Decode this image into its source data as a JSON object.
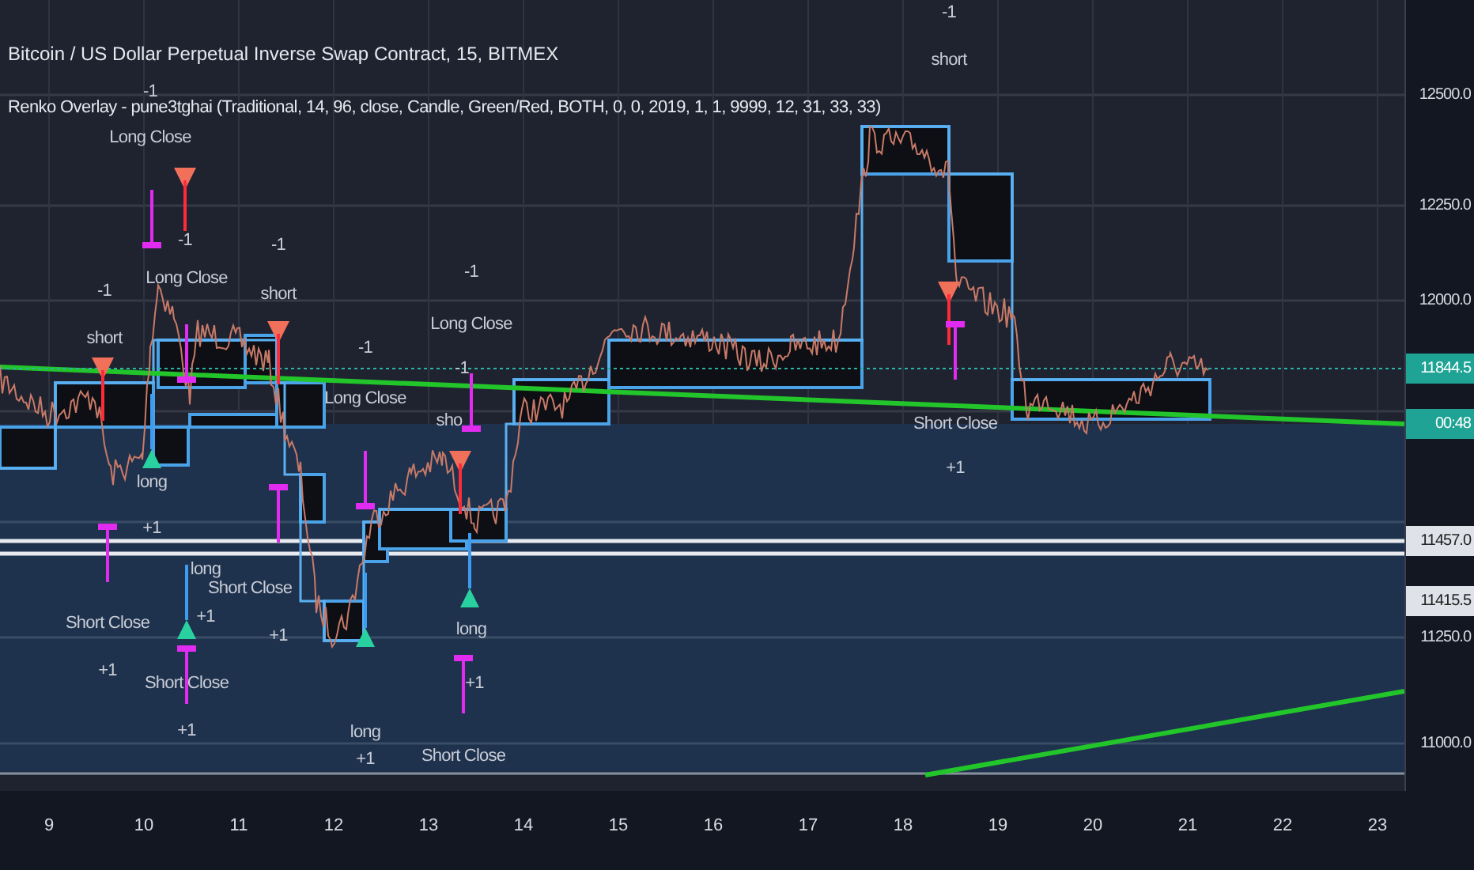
{
  "chart": {
    "title": "Bitcoin / US Dollar Perpetual Inverse Swap Contract, 15, BITMEX",
    "indicator": "Renko Overlay - pune3tghai (Traditional, 14, 96, close, Candle, Green/Red, BOTH, 0, 0, 2019, 1, 1, 9999, 12, 31, 33, 33)",
    "signal_labels": [
      {
        "text": "-1"
      },
      {
        "text": "Long Close"
      },
      {
        "text": "-1"
      },
      {
        "text": "Long Close"
      },
      {
        "text": "-1"
      },
      {
        "text": "short"
      },
      {
        "text": "-1"
      },
      {
        "text": "short"
      },
      {
        "text": "-1"
      },
      {
        "text": "Long Close"
      },
      {
        "text": "-1"
      },
      {
        "text": "Long Close"
      },
      {
        "text": "-1"
      },
      {
        "text": "sho"
      },
      {
        "text": "long"
      },
      {
        "text": "+1"
      },
      {
        "text": "long"
      },
      {
        "text": "+1"
      },
      {
        "text": "Short Close"
      },
      {
        "text": "+1"
      },
      {
        "text": "Short Close"
      },
      {
        "text": "+1"
      },
      {
        "text": "Short Close"
      },
      {
        "text": "+1"
      },
      {
        "text": "long"
      },
      {
        "text": "+1"
      },
      {
        "text": "long"
      },
      {
        "text": "+1"
      },
      {
        "text": "Short Close"
      },
      {
        "text": "-1"
      },
      {
        "text": "short"
      },
      {
        "text": "Short Close"
      },
      {
        "text": "+1"
      }
    ],
    "price_axis": {
      "ticks": [
        "12500.0",
        "12250.0",
        "12000.0",
        "11250.0",
        "11000.0"
      ],
      "badges": [
        {
          "label": "11844.5",
          "kind": "last_price"
        },
        {
          "label": "00:48",
          "kind": "countdown"
        },
        {
          "label": "11457.0",
          "kind": "level"
        },
        {
          "label": "11415.5",
          "kind": "level"
        }
      ]
    },
    "time_axis": {
      "ticks": [
        "9",
        "10",
        "11",
        "12",
        "13",
        "14",
        "15",
        "16",
        "17",
        "18",
        "19",
        "20",
        "21",
        "22",
        "23"
      ]
    }
  }
}
